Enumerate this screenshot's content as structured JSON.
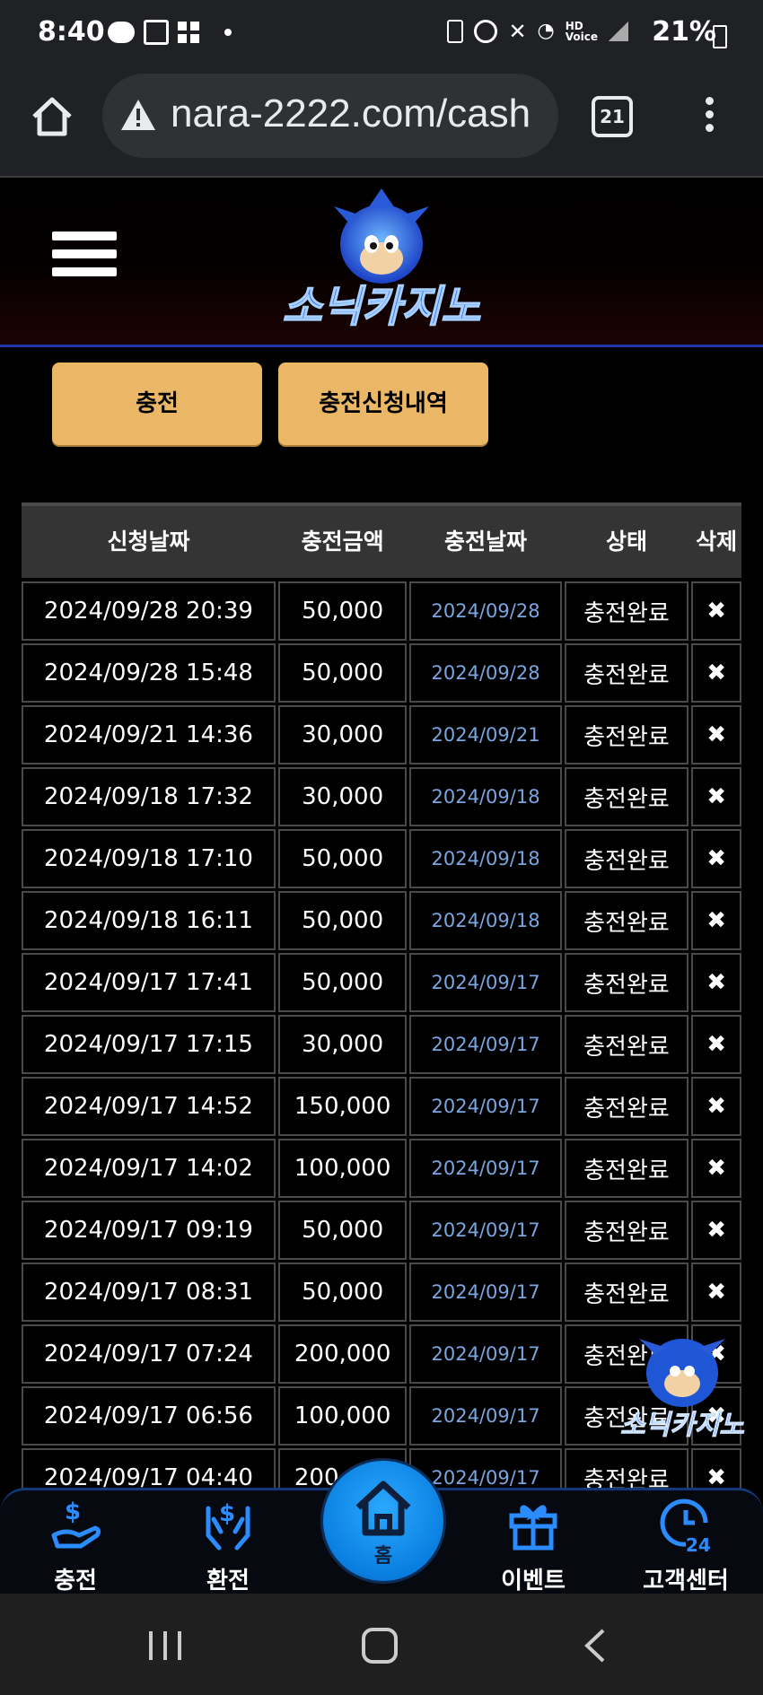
{
  "status_bar": {
    "time": "8:40",
    "battery": "21%"
  },
  "browser": {
    "url": "nara-2222.com/cash",
    "tab_count": "21"
  },
  "site": {
    "logo_text": "소닉카지노"
  },
  "buttons": {
    "charge": "충전",
    "history": "충전신청내역"
  },
  "table": {
    "headers": [
      "신청날짜",
      "충전금액",
      "충전날짜",
      "상태",
      "삭제"
    ],
    "delete_glyph": "✖",
    "rows": [
      {
        "req": "2024/09/28 20:39",
        "amount": "50,000",
        "date": "2024/09/28",
        "status": "충전완료"
      },
      {
        "req": "2024/09/28 15:48",
        "amount": "50,000",
        "date": "2024/09/28",
        "status": "충전완료"
      },
      {
        "req": "2024/09/21 14:36",
        "amount": "30,000",
        "date": "2024/09/21",
        "status": "충전완료"
      },
      {
        "req": "2024/09/18 17:32",
        "amount": "30,000",
        "date": "2024/09/18",
        "status": "충전완료"
      },
      {
        "req": "2024/09/18 17:10",
        "amount": "50,000",
        "date": "2024/09/18",
        "status": "충전완료"
      },
      {
        "req": "2024/09/18 16:11",
        "amount": "50,000",
        "date": "2024/09/18",
        "status": "충전완료"
      },
      {
        "req": "2024/09/17 17:41",
        "amount": "50,000",
        "date": "2024/09/17",
        "status": "충전완료"
      },
      {
        "req": "2024/09/17 17:15",
        "amount": "30,000",
        "date": "2024/09/17",
        "status": "충전완료"
      },
      {
        "req": "2024/09/17 14:52",
        "amount": "150,000",
        "date": "2024/09/17",
        "status": "충전완료"
      },
      {
        "req": "2024/09/17 14:02",
        "amount": "100,000",
        "date": "2024/09/17",
        "status": "충전완료"
      },
      {
        "req": "2024/09/17 09:19",
        "amount": "50,000",
        "date": "2024/09/17",
        "status": "충전완료"
      },
      {
        "req": "2024/09/17 08:31",
        "amount": "50,000",
        "date": "2024/09/17",
        "status": "충전완료"
      },
      {
        "req": "2024/09/17 07:24",
        "amount": "200,000",
        "date": "2024/09/17",
        "status": "충전완료"
      },
      {
        "req": "2024/09/17 06:56",
        "amount": "100,000",
        "date": "2024/09/17",
        "status": "충전완료"
      },
      {
        "req": "2024/09/17 04:40",
        "amount": "200,000",
        "date": "2024/09/17",
        "status": "충전완료"
      }
    ]
  },
  "bottom_nav": {
    "charge": "충전",
    "exchange": "환전",
    "home": "홈",
    "event": "이벤트",
    "support": "고객센터"
  }
}
